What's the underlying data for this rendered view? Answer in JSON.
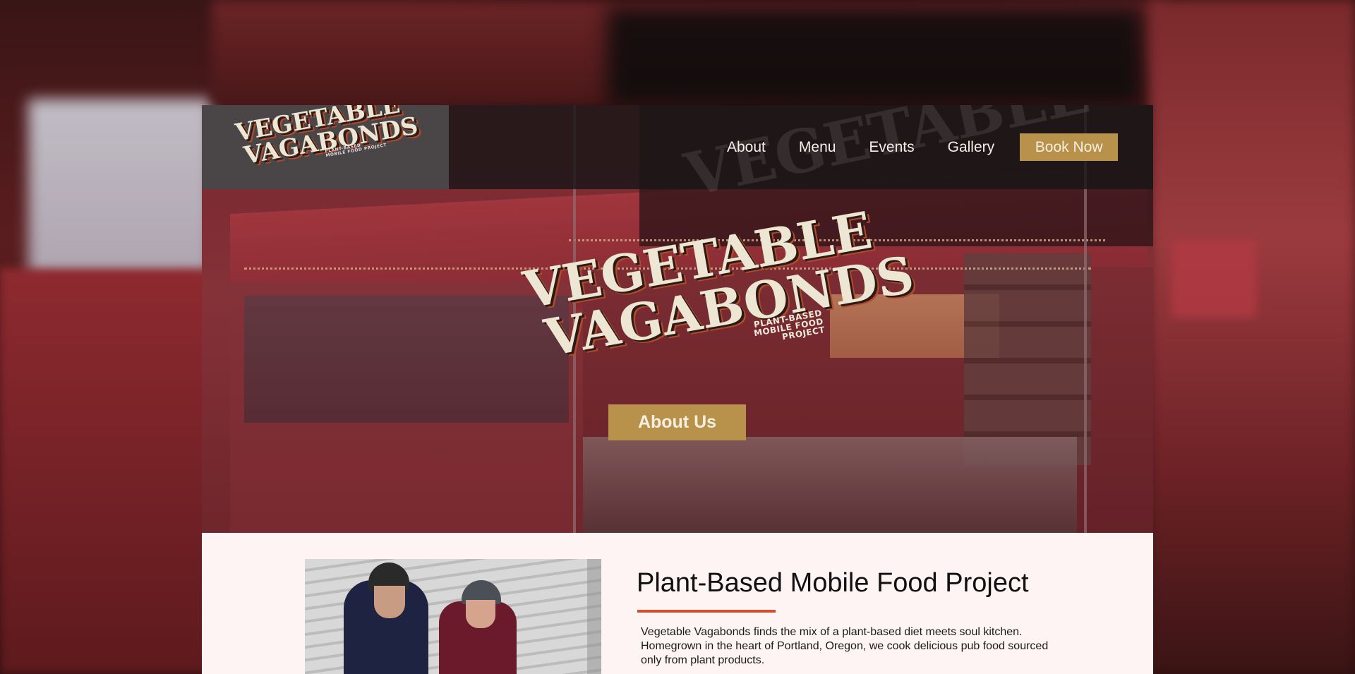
{
  "brand": {
    "name_line1": "VEGETABLE",
    "name_line2": "VAGABONDS",
    "tagline_line1": "PLANT-BASED",
    "tagline_line2": "MOBILE FOOD PROJECT"
  },
  "nav": {
    "items": [
      {
        "label": "About"
      },
      {
        "label": "Menu"
      },
      {
        "label": "Events"
      },
      {
        "label": "Gallery"
      }
    ],
    "cta_label": "Book Now"
  },
  "hero": {
    "cta_label": "About Us"
  },
  "intro": {
    "title": "Plant-Based Mobile Food Project",
    "body": "Vegetable Vagabonds finds the mix of a plant-based diet meets soul kitchen. Homegrown in the heart of Portland, Oregon, we cook delicious pub food sourced only from plant products."
  },
  "colors": {
    "accent_gold": "#b8914a",
    "divider_orange": "#d2502f",
    "section_bg": "#fff4f4",
    "nav_bg": "#191617"
  }
}
